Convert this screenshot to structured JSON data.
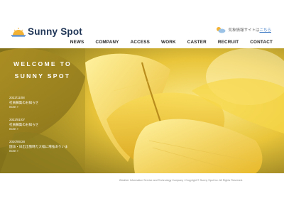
{
  "brand": {
    "name": "Sunny Spot"
  },
  "weather": {
    "text": "気象情報サイトは",
    "link_label": "こちら"
  },
  "nav": {
    "items": [
      {
        "label": "NEWS"
      },
      {
        "label": "COMPANY"
      },
      {
        "label": "ACCESS"
      },
      {
        "label": "WORK"
      },
      {
        "label": "CASTER"
      },
      {
        "label": "RECRUIT"
      },
      {
        "label": "CONTACT"
      }
    ]
  },
  "hero": {
    "welcome_line1": "WELCOME TO",
    "welcome_line2": "SUNNY SPOT"
  },
  "news": {
    "items": [
      {
        "date": "2022/11/08",
        "title": "社員募集のお知らせ",
        "more": "more »"
      },
      {
        "date": "2022/01/07",
        "title": "社員募集のお知らせ",
        "more": "more »"
      },
      {
        "date": "2020/05/28",
        "title": "国派・日出出張時た大幅に増強ありいま",
        "more": "more »"
      }
    ]
  },
  "footer": {
    "text": "Weather Information Service and Technology Company / Copyright © Sunny Spot Inc. All Rights Reserved."
  },
  "colors": {
    "brand_navy": "#1f3556",
    "accent_link": "#3a78c2",
    "hero_yellow": "#f2cf3a"
  }
}
